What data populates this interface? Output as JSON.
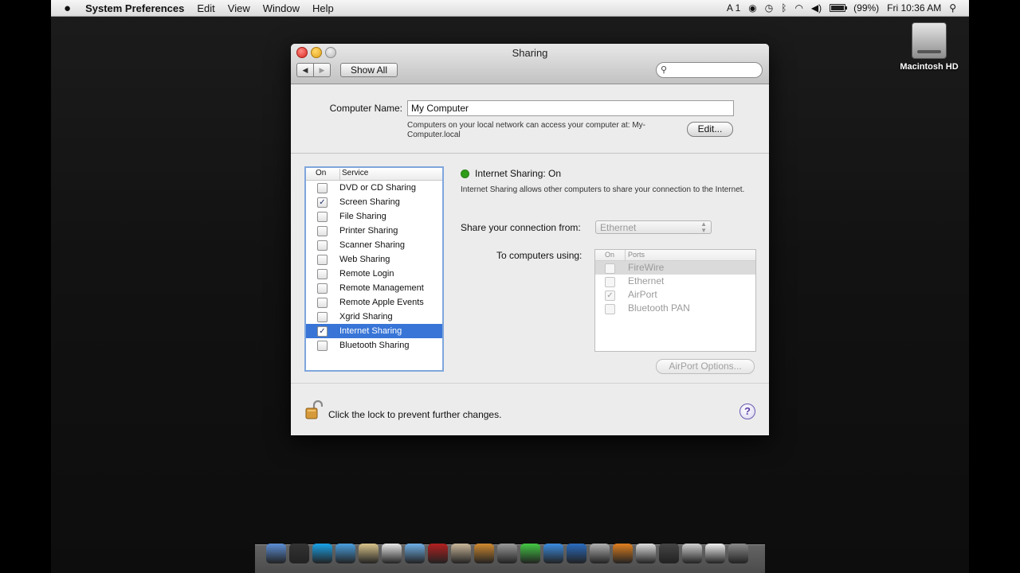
{
  "menubar": {
    "apple": "",
    "app_name": "System Preferences",
    "menus": [
      "Edit",
      "View",
      "Window",
      "Help"
    ],
    "status": {
      "input_indicator": "A 1",
      "battery_text": "(99%)",
      "battery_level": 0.99,
      "clock": "Fri 10:36 AM"
    }
  },
  "desktop": {
    "disk_label": "Macintosh HD"
  },
  "window": {
    "title": "Sharing",
    "back_glyph": "◀",
    "forward_glyph": "▶",
    "show_all": "Show All",
    "search_placeholder": ""
  },
  "computer_name": {
    "label": "Computer Name:",
    "value": "My Computer",
    "description": "Computers on your local network can access your computer at: My-Computer.local",
    "edit_button": "Edit..."
  },
  "services": {
    "header_on": "On",
    "header_service": "Service",
    "items": [
      {
        "label": "DVD or CD Sharing",
        "checked": "",
        "selected": false
      },
      {
        "label": "Screen Sharing",
        "checked": "✓",
        "selected": false
      },
      {
        "label": "File Sharing",
        "checked": "",
        "selected": false
      },
      {
        "label": "Printer Sharing",
        "checked": "",
        "selected": false
      },
      {
        "label": "Scanner Sharing",
        "checked": "",
        "selected": false
      },
      {
        "label": "Web Sharing",
        "checked": "",
        "selected": false
      },
      {
        "label": "Remote Login",
        "checked": "",
        "selected": false
      },
      {
        "label": "Remote Management",
        "checked": "",
        "selected": false
      },
      {
        "label": "Remote Apple Events",
        "checked": "",
        "selected": false
      },
      {
        "label": "Xgrid Sharing",
        "checked": "",
        "selected": false
      },
      {
        "label": "Internet Sharing",
        "checked": "✓",
        "selected": true
      },
      {
        "label": "Bluetooth Sharing",
        "checked": "",
        "selected": false
      }
    ]
  },
  "detail": {
    "status_title": "Internet Sharing: On",
    "status_color": "#2f9c1a",
    "description": "Internet Sharing allows other computers to share your connection to the Internet.",
    "share_from_label": "Share your connection from:",
    "share_from_value": "Ethernet",
    "to_label": "To computers using:",
    "ports_header_on": "On",
    "ports_header_ports": "Ports",
    "ports": [
      {
        "label": "FireWire",
        "checked": ""
      },
      {
        "label": "Ethernet",
        "checked": ""
      },
      {
        "label": "AirPort",
        "checked": "✓"
      },
      {
        "label": "Bluetooth PAN",
        "checked": ""
      }
    ],
    "airport_options": "AirPort Options..."
  },
  "footer": {
    "lock_text": "Click the lock to prevent further changes.",
    "help": "?"
  },
  "dock": {
    "icons": [
      {
        "name": "finder-icon",
        "color": "#5c8fd6"
      },
      {
        "name": "dashboard-icon",
        "color": "#333333"
      },
      {
        "name": "skype-icon",
        "color": "#1aa3e8"
      },
      {
        "name": "safari-icon",
        "color": "#4aa0e0"
      },
      {
        "name": "notes-icon",
        "color": "#d9c48a"
      },
      {
        "name": "calendar-icon",
        "color": "#e8e8e8"
      },
      {
        "name": "itunes-icon",
        "color": "#6fb0e8"
      },
      {
        "name": "book-icon",
        "color": "#b52020"
      },
      {
        "name": "preview-icon",
        "color": "#c9b79a"
      },
      {
        "name": "photo-icon",
        "color": "#d08a30"
      },
      {
        "name": "system-preferences-icon",
        "color": "#9a9a9a"
      },
      {
        "name": "facetime-icon",
        "color": "#44c844"
      },
      {
        "name": "chat-icon",
        "color": "#3c8de0"
      },
      {
        "name": "network-icon",
        "color": "#2a6cc0"
      },
      {
        "name": "utility-icon",
        "color": "#b0b0b0"
      },
      {
        "name": "firefox-icon",
        "color": "#e08020"
      },
      {
        "name": "phone-icon",
        "color": "#dddddd"
      },
      {
        "name": "music-icon",
        "color": "#444444"
      },
      {
        "name": "printer-icon",
        "color": "#cfcfcf"
      },
      {
        "name": "file-icon",
        "color": "#f0f0f0"
      },
      {
        "name": "trash-icon",
        "color": "#8a8a8a"
      }
    ]
  }
}
